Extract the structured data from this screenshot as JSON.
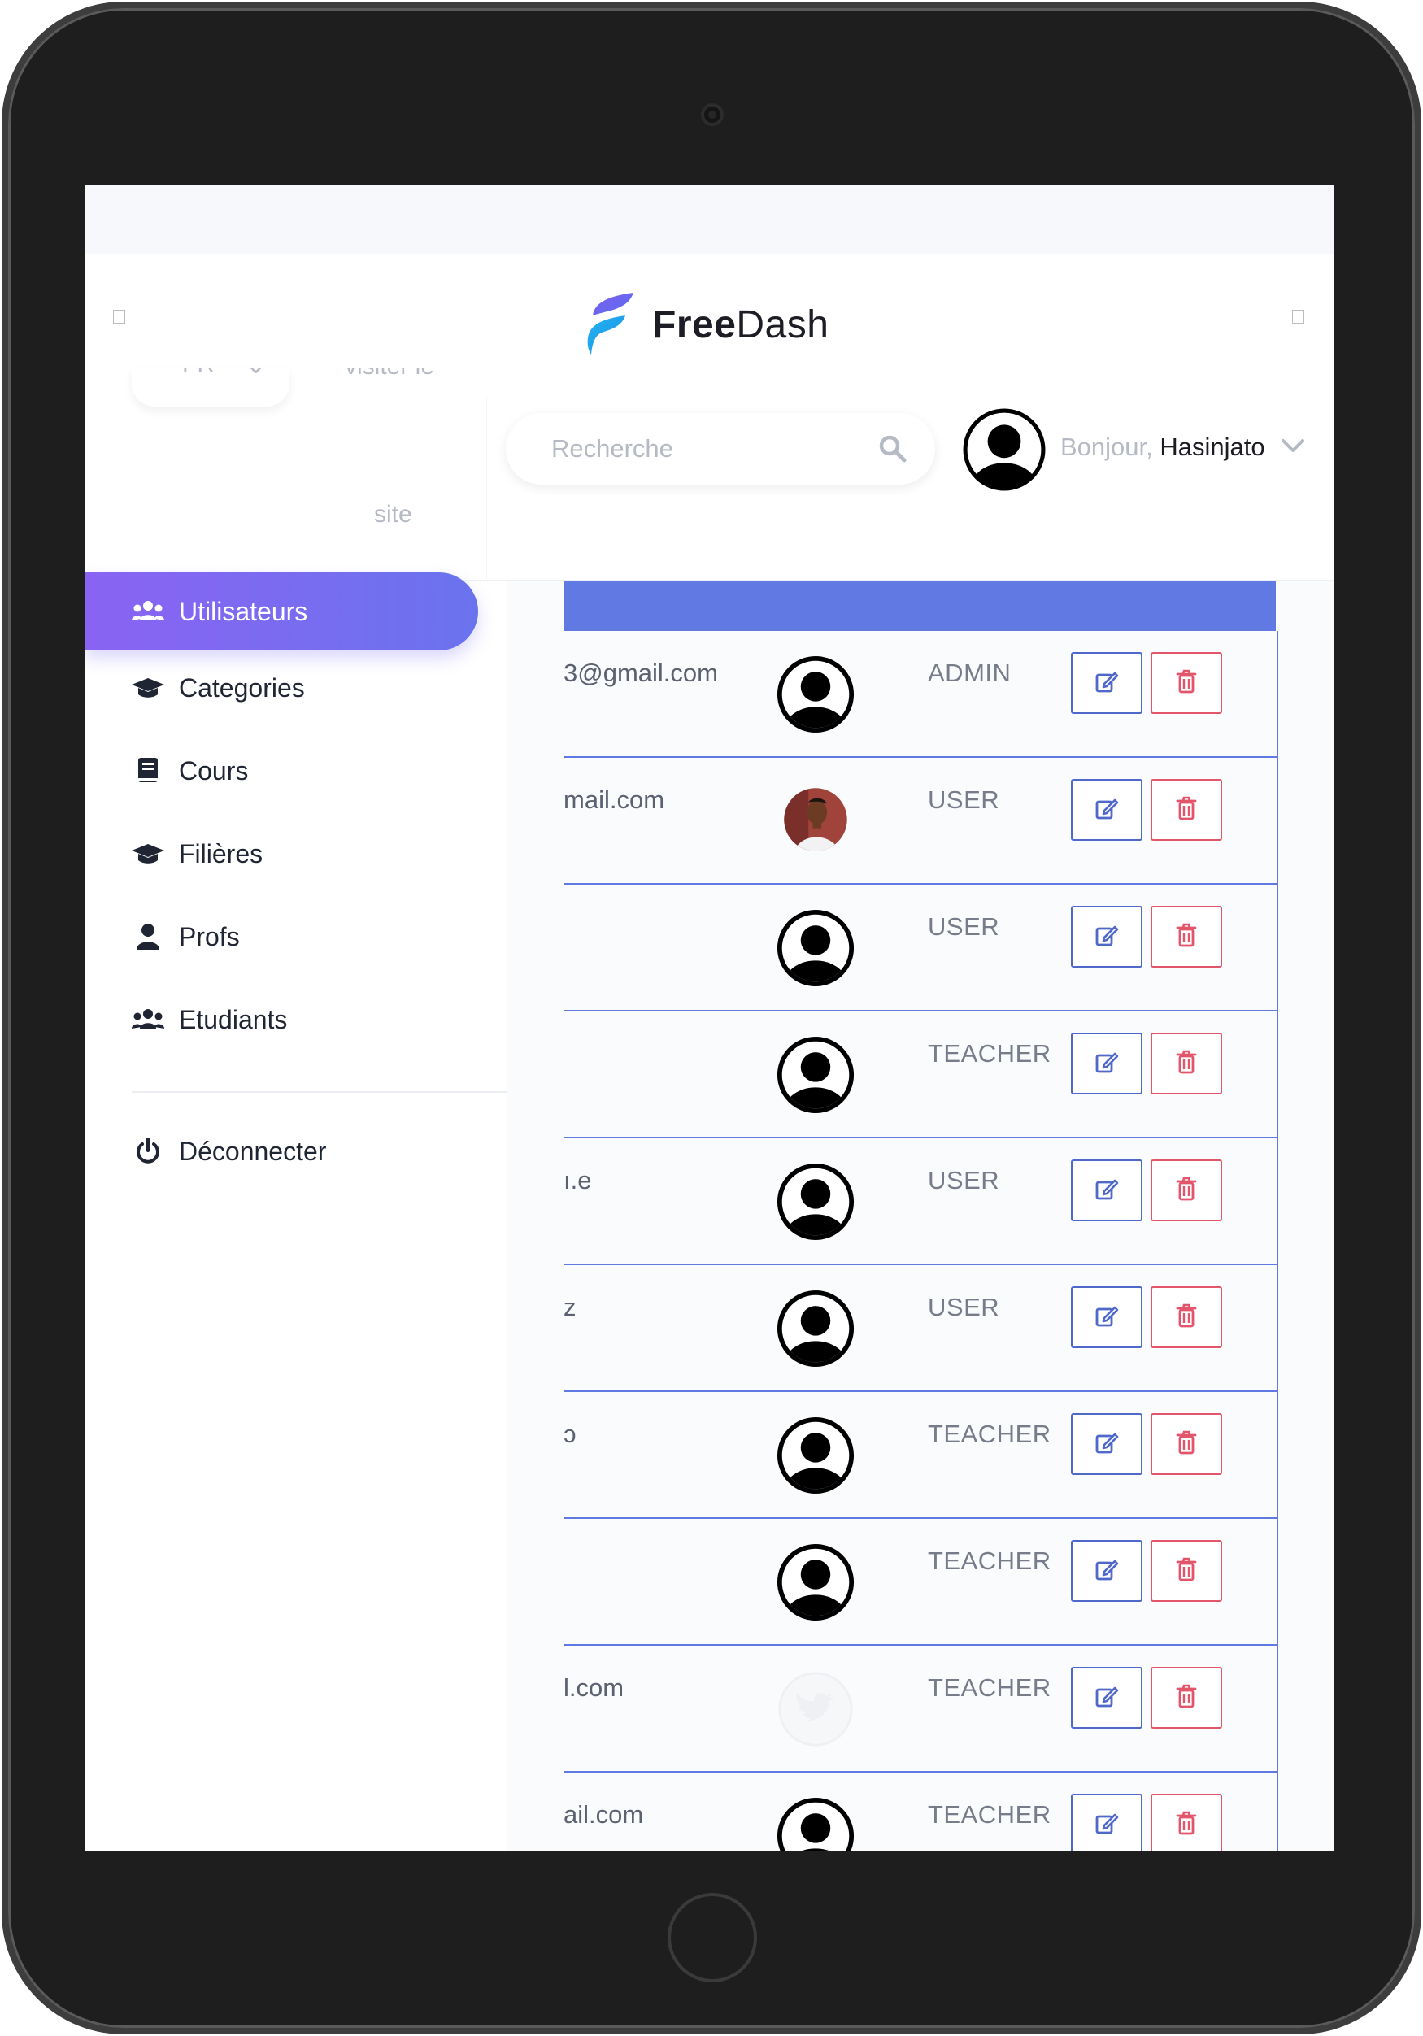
{
  "brand": {
    "name_bold": "Free",
    "name_light": "Dash"
  },
  "header": {
    "lang_label": "FR",
    "visit_label": "visiter le",
    "site_label": "site",
    "search_placeholder": "Recherche",
    "greeting": "Bonjour,",
    "username": "Hasinjato"
  },
  "sidebar": {
    "items": [
      {
        "label": "Utilisateurs",
        "icon": "users-icon",
        "active": true
      },
      {
        "label": "Categories",
        "icon": "graduation-cap-icon",
        "active": false
      },
      {
        "label": "Cours",
        "icon": "book-icon",
        "active": false
      },
      {
        "label": "Filières",
        "icon": "graduation-cap-icon",
        "active": false
      },
      {
        "label": "Profs",
        "icon": "user-icon",
        "active": false
      },
      {
        "label": "Etudiants",
        "icon": "users-icon",
        "active": false
      }
    ],
    "logout_label": "Déconnecter"
  },
  "users": [
    {
      "email": "3@gmail.com",
      "role": "ADMIN",
      "avatar": "default-avatar"
    },
    {
      "email": "mail.com",
      "role": "USER",
      "avatar": "photo-avatar"
    },
    {
      "email": "",
      "role": "USER",
      "avatar": "default-avatar"
    },
    {
      "email": "",
      "role": "TEACHER",
      "avatar": "default-avatar"
    },
    {
      "email": "ı.e",
      "role": "USER",
      "avatar": "default-avatar"
    },
    {
      "email": "z",
      "role": "USER",
      "avatar": "default-avatar"
    },
    {
      "email": "ɔ",
      "role": "TEACHER",
      "avatar": "default-avatar"
    },
    {
      "email": "",
      "role": "TEACHER",
      "avatar": "default-avatar"
    },
    {
      "email": "l.com",
      "role": "TEACHER",
      "avatar": "twitter-avatar"
    },
    {
      "email": "ail.com",
      "role": "TEACHER",
      "avatar": "default-avatar"
    }
  ],
  "colors": {
    "accent": "#6079e3",
    "active_gradient_start": "#8a63f3",
    "active_gradient_end": "#6a73ee",
    "edit": "#4f68c9",
    "delete": "#e3556a"
  }
}
